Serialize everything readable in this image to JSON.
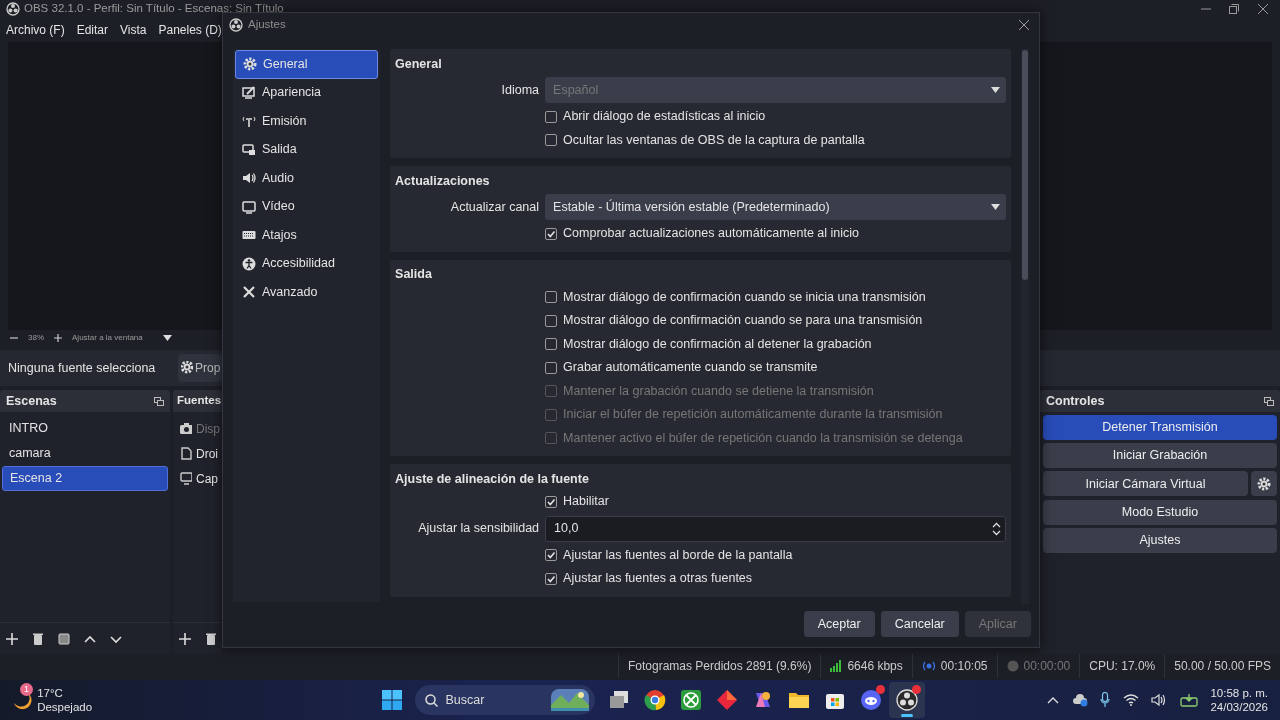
{
  "window": {
    "title": "OBS 32.1.0 - Perfil: Sin Título - Escenas: Sin Título"
  },
  "menu": [
    "Archivo (F)",
    "Editar",
    "Vista",
    "Paneles (D)"
  ],
  "zoom_bar": {
    "zoom": "38%",
    "fit": "Ajustar a la ventana"
  },
  "context_bar": {
    "label": "Ninguna fuente selecciona",
    "properties_button": "Prop"
  },
  "scenes": {
    "title": "Escenas",
    "items": [
      {
        "label": "INTRO",
        "selected": false
      },
      {
        "label": "camara",
        "selected": false
      },
      {
        "label": "Escena 2",
        "selected": true
      }
    ]
  },
  "sources": {
    "title": "Fuentes",
    "items": [
      {
        "label": "Disp",
        "kind": "camera",
        "disabled": true
      },
      {
        "label": "Droi",
        "kind": "file",
        "disabled": false
      },
      {
        "label": "Cap",
        "kind": "monitor",
        "disabled": false
      }
    ]
  },
  "controls": {
    "title": "Controles",
    "buttons": [
      {
        "label": "Detener Transmisión",
        "active": true,
        "gear": false
      },
      {
        "label": "Iniciar Grabación",
        "active": false,
        "gear": false
      },
      {
        "label": "Iniciar Cámara Virtual",
        "active": false,
        "gear": true
      },
      {
        "label": "Modo Estudio",
        "active": false,
        "gear": false
      },
      {
        "label": "Ajustes",
        "active": false,
        "gear": false
      }
    ]
  },
  "status_bar": {
    "dropped": "Fotogramas Perdidos 2891 (9.6%)",
    "bitrate": "6646 kbps",
    "stream_time": "00:10:05",
    "record_time": "00:00:00",
    "cpu": "CPU: 17.0%",
    "fps": "50.00 / 50.00 FPS"
  },
  "dialog": {
    "title": "Ajustes",
    "nav": [
      {
        "label": "General",
        "kind": "gear",
        "selected": true
      },
      {
        "label": "Apariencia",
        "kind": "appearance",
        "selected": false
      },
      {
        "label": "Emisión",
        "kind": "antenna",
        "selected": false
      },
      {
        "label": "Salida",
        "kind": "output",
        "selected": false
      },
      {
        "label": "Audio",
        "kind": "speaker",
        "selected": false
      },
      {
        "label": "Vídeo",
        "kind": "monitor",
        "selected": false
      },
      {
        "label": "Atajos",
        "kind": "keyboard",
        "selected": false
      },
      {
        "label": "Accesibilidad",
        "kind": "accessibility",
        "selected": false
      },
      {
        "label": "Avanzado",
        "kind": "tools",
        "selected": false
      }
    ],
    "sections": [
      {
        "title": "General",
        "rows": [
          {
            "kind": "select",
            "label": "Idioma",
            "value": "Español",
            "disabled": true
          },
          {
            "kind": "checkbox",
            "label": "Abrir diálogo de estadísticas al inicio",
            "checked": false,
            "disabled": false
          },
          {
            "kind": "checkbox",
            "label": "Ocultar las ventanas de OBS de la captura de pantalla",
            "checked": false,
            "disabled": false
          }
        ]
      },
      {
        "title": "Actualizaciones",
        "rows": [
          {
            "kind": "select",
            "label": "Actualizar canal",
            "value": "Estable - Última versión estable (Predeterminado)",
            "disabled": false
          },
          {
            "kind": "checkbox",
            "label": "Comprobar actualizaciones automáticamente al inicio",
            "checked": true,
            "disabled": false
          }
        ]
      },
      {
        "title": "Salida",
        "rows": [
          {
            "kind": "checkbox",
            "label": "Mostrar diálogo de confirmación cuando se inicia una transmisión",
            "checked": false,
            "disabled": false
          },
          {
            "kind": "checkbox",
            "label": "Mostrar diálogo de confirmación cuando se para una transmisión",
            "checked": false,
            "disabled": false
          },
          {
            "kind": "checkbox",
            "label": "Mostrar diálogo de confirmación al detener la grabación",
            "checked": false,
            "disabled": false
          },
          {
            "kind": "checkbox",
            "label": "Grabar automáticamente cuando se transmite",
            "checked": false,
            "disabled": false
          },
          {
            "kind": "checkbox",
            "label": "Mantener la grabación cuando se detiene la transmisión",
            "checked": false,
            "disabled": true
          },
          {
            "kind": "checkbox",
            "label": "Iniciar el búfer de repetición automáticamente durante la transmisión",
            "checked": false,
            "disabled": true
          },
          {
            "kind": "checkbox",
            "label": "Mantener activo el búfer de repetición cuando la transmisión se detenga",
            "checked": false,
            "disabled": true
          }
        ]
      },
      {
        "title": "Ajuste de alineación de la fuente",
        "rows": [
          {
            "kind": "checkbox",
            "label": "Habilitar",
            "checked": true,
            "disabled": false
          },
          {
            "kind": "spin",
            "label": "Ajustar la sensibilidad",
            "value": "10,0"
          },
          {
            "kind": "checkbox",
            "label": "Ajustar las fuentes al borde de la pantalla",
            "checked": true,
            "disabled": false
          },
          {
            "kind": "checkbox",
            "label": "Ajustar las fuentes a otras fuentes",
            "checked": true,
            "disabled": false
          }
        ]
      }
    ],
    "buttons": [
      {
        "label": "Aceptar",
        "disabled": false
      },
      {
        "label": "Cancelar",
        "disabled": false
      },
      {
        "label": "Aplicar",
        "disabled": true
      }
    ]
  },
  "taskbar": {
    "weather_badge": "1",
    "weather_temp": "17°C",
    "weather_text": "Despejado",
    "search_placeholder": "Buscar",
    "apps": [
      {
        "kind": "taskview",
        "active": false,
        "badge": false
      },
      {
        "kind": "browser",
        "active": false,
        "badge": false
      },
      {
        "kind": "game",
        "active": false,
        "badge": false
      },
      {
        "kind": "diamond",
        "active": false,
        "badge": false
      },
      {
        "kind": "swirl",
        "active": false,
        "badge": false
      },
      {
        "kind": "folder",
        "active": false,
        "badge": false
      },
      {
        "kind": "store",
        "active": false,
        "badge": false
      },
      {
        "kind": "chat",
        "active": false,
        "badge": true
      },
      {
        "kind": "recorder",
        "active": true,
        "badge": true
      }
    ],
    "time": "10:58 p. m.",
    "date": "24/03/2026"
  }
}
